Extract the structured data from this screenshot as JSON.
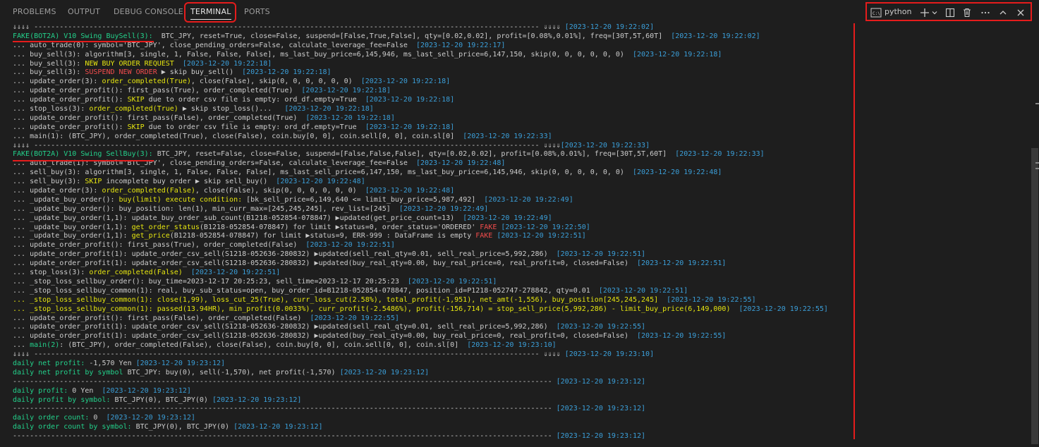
{
  "tabs": [
    {
      "label": "PROBLEMS"
    },
    {
      "label": "OUTPUT"
    },
    {
      "label": "DEBUG CONSOLE"
    },
    {
      "label": "TERMINAL"
    },
    {
      "label": "PORTS"
    }
  ],
  "toolbar": {
    "terminal_name": "python",
    "icons": [
      "terminal-icon",
      "plus-icon",
      "chevron-down-icon",
      "split-icon",
      "trash-icon",
      "more-icon",
      "chevron-up-icon",
      "close-icon"
    ]
  },
  "colors": {
    "timestamp": "#3b9fd9",
    "green": "#23d18b",
    "yellow": "#e5e510",
    "red": "#f14c4c",
    "highlight": "#e51c1c"
  },
  "lines": [
    [
      [
        "sep",
        "⇓⇓⇓⇓ ----------------------------------------------------------------------------------------------------------------------- ⇓⇓⇓⇓ "
      ],
      [
        "ts",
        "[2023-12-20 19:22:02]"
      ]
    ],
    [
      [
        "green",
        "FAKE(BOT2A) V10 Swing BuySell(3):"
      ],
      [
        "",
        "  BTC_JPY, reset=True, close=False, suspend=[False,True,False], qty=[0.02,0.02], profit=[0.08%,0.01%], freq=[30T,5T,60T]  "
      ],
      [
        "ts",
        "[2023-12-20 19:22:02]"
      ]
    ],
    [
      [
        "",
        "... auto_trade(0): symbol='BTC_JPY', close_pending_orders=False, calculate_leverage_fee=False  "
      ],
      [
        "ts",
        "[2023-12-20 19:22:17]"
      ]
    ],
    [
      [
        "",
        "... buy_sell(3): algorithm[3, single, 1, False, False, False], ms_last_buy_price=6,145,946, ms_last_sell_price=6,147,150, skip(0, 0, 0, 0, 0, 0)  "
      ],
      [
        "ts",
        "[2023-12-20 19:22:18]"
      ]
    ],
    [
      [
        "",
        "... buy_sell(3): "
      ],
      [
        "yellow",
        "NEW BUY ORDER REQUEST"
      ],
      [
        "",
        "  "
      ],
      [
        "ts",
        "[2023-12-20 19:22:18]"
      ]
    ],
    [
      [
        "",
        "... buy_sell(3): "
      ],
      [
        "red",
        "SUSPEND NEW ORDER"
      ],
      [
        "",
        " ▶ skip buy_sell()  "
      ],
      [
        "ts",
        "[2023-12-20 19:22:18]"
      ]
    ],
    [
      [
        "",
        "... update_order(3): "
      ],
      [
        "yellow",
        "order_completed(True)"
      ],
      [
        "",
        ", close(False), skip(0, 0, 0, 0, 0, 0)  "
      ],
      [
        "ts",
        "[2023-12-20 19:22:18]"
      ]
    ],
    [
      [
        "",
        "... update_order_profit(): first_pass(True), order_completed(True)  "
      ],
      [
        "ts",
        "[2023-12-20 19:22:18]"
      ]
    ],
    [
      [
        "",
        "... update_order_profit(): "
      ],
      [
        "yellow",
        "SKIP"
      ],
      [
        "",
        " due to order csv file is empty: ord_df.empty=True  "
      ],
      [
        "ts",
        "[2023-12-20 19:22:18]"
      ]
    ],
    [
      [
        "",
        "... stop_loss(3): "
      ],
      [
        "yellow",
        "order_completed(True)"
      ],
      [
        "",
        " ▶ skip stop_loss()...   "
      ],
      [
        "ts",
        "[2023-12-20 19:22:18]"
      ]
    ],
    [
      [
        "",
        "... update_order_profit(): first_pass(False), order_completed(True)  "
      ],
      [
        "ts",
        "[2023-12-20 19:22:18]"
      ]
    ],
    [
      [
        "",
        "... update_order_profit(): "
      ],
      [
        "yellow",
        "SKIP"
      ],
      [
        "",
        " due to order csv file is empty: ord_df.empty=True  "
      ],
      [
        "ts",
        "[2023-12-20 19:22:18]"
      ]
    ],
    [
      [
        "",
        "... main(1): (BTC_JPY), order_completed(True), close(False), coin.buy[0, 0], coin.sell[0, 0], coin.sl[0]  "
      ],
      [
        "ts",
        "[2023-12-20 19:22:33]"
      ]
    ],
    [
      [
        "sep",
        "⇓⇓⇓⇓ ----------------------------------------------------------------------------------------------------------------------- ⇓⇓⇓⇓"
      ],
      [
        "ts",
        "[2023-12-20 19:22:33]"
      ]
    ],
    [
      [
        "green",
        "FAKE(BOT2A) V10 Swing SellBuy(3):"
      ],
      [
        "",
        " BTC_JPY, reset=False, close=False, suspend=[False,False,False], qty=[0.02,0.02], profit=[0.08%,0.01%], freq=[30T,5T,60T]  "
      ],
      [
        "ts",
        "[2023-12-20 19:22:33]"
      ]
    ],
    [
      [
        "",
        "... auto_trade(1): symbol='BTC_JPY', close_pending_orders=False, calculate_leverage_fee=False  "
      ],
      [
        "ts",
        "[2023-12-20 19:22:48]"
      ]
    ],
    [
      [
        "",
        "... sell_buy(3): algorithm[3, single, 1, False, False, False], ms_last_sell_price=6,147,150, ms_last_buy_price=6,145,946, skip(0, 0, 0, 0, 0, 0)  "
      ],
      [
        "ts",
        "[2023-12-20 19:22:48]"
      ]
    ],
    [
      [
        "",
        "... sell_buy(3): "
      ],
      [
        "yellow",
        "SKIP"
      ],
      [
        "",
        " incomplete buy order ▶ skip sell_buy()  "
      ],
      [
        "ts",
        "[2023-12-20 19:22:48]"
      ]
    ],
    [
      [
        "",
        "... update_order(3): "
      ],
      [
        "yellow",
        "order_completed(False)"
      ],
      [
        "",
        ", close(False), skip(0, 0, 0, 0, 0, 0)  "
      ],
      [
        "ts",
        "[2023-12-20 19:22:48]"
      ]
    ],
    [
      [
        "",
        "... _update_buy_order(): "
      ],
      [
        "yellow",
        "buy(limit) execute condition:"
      ],
      [
        "",
        " [bk_sell_price=6,149,640 <= limit_buy_price=5,987,492]  "
      ],
      [
        "ts",
        "[2023-12-20 19:22:49]"
      ]
    ],
    [
      [
        "",
        "... _update_buy_order(): buy_position: len(1), min_curr_max=[245,245,245], rev_list=[245]  "
      ],
      [
        "ts",
        "[2023-12-20 19:22:49]"
      ]
    ],
    [
      [
        "",
        "... _update_buy_order(1,1): update_buy_order_sub_count(B1218-052854-078847) ▶updated(get_price_count=13)  "
      ],
      [
        "ts",
        "[2023-12-20 19:22:49]"
      ]
    ],
    [
      [
        "",
        "... _update_buy_order(1,1): "
      ],
      [
        "yellow",
        "get_order_status"
      ],
      [
        "",
        "(B1218-052854-078847) for limit ▶status=0, order_status='ORDERED' "
      ],
      [
        "red",
        "FAKE"
      ],
      [
        "",
        " "
      ],
      [
        "ts",
        "[2023-12-20 19:22:50]"
      ]
    ],
    [
      [
        "",
        "... _update_buy_order(1,1): "
      ],
      [
        "yellow",
        "get_price"
      ],
      [
        "",
        "(B1218-052854-078847) for limit ▶status=9, ERR-999 : DataFrame is empty "
      ],
      [
        "red",
        "FAKE"
      ],
      [
        "",
        " "
      ],
      [
        "ts",
        "[2023-12-20 19:22:51]"
      ]
    ],
    [
      [
        "",
        "... update_order_profit(): first_pass(True), order_completed(False)  "
      ],
      [
        "ts",
        "[2023-12-20 19:22:51]"
      ]
    ],
    [
      [
        "",
        "... update_order_profit(1): update_order_csv_sell(S1218-052636-280832) ▶updated(sell_real_qty=0.01, sell_real_price=5,992,286)  "
      ],
      [
        "ts",
        "[2023-12-20 19:22:51]"
      ]
    ],
    [
      [
        "",
        "... update_order_profit(1): update_order_csv_sell(S1218-052636-280832) ▶updated(buy_real_qty=0.00, buy_real_price=0, real_profit=0, closed=False)  "
      ],
      [
        "ts",
        "[2023-12-20 19:22:51]"
      ]
    ],
    [
      [
        "",
        "... stop_loss(3): "
      ],
      [
        "yellow",
        "order_completed(False)"
      ],
      [
        "",
        "  "
      ],
      [
        "ts",
        "[2023-12-20 19:22:51]"
      ]
    ],
    [
      [
        "",
        "... _stop_loss_sellbuy_order(): buy_time=2023-12-17 20:25:23, sell_time=2023-12-17 20:25:23  "
      ],
      [
        "ts",
        "[2023-12-20 19:22:51]"
      ]
    ],
    [
      [
        "",
        "... _stop_loss_sellbuy_common(1): real, buy_sub_status=open, buy_order_id=B1218-052854-078847, position_id=P1218-052747-278842, qty=0.01  "
      ],
      [
        "ts",
        "[2023-12-20 19:22:51]"
      ]
    ],
    [
      [
        "yellow",
        "... _stop_loss_sellbuy_common(1): close(1,99), loss_cut_25(True), curr_loss_cut(2.58%), total_profit(-1,951), net_amt(-1,556), buy_position[245,245,245]"
      ],
      [
        "",
        "  "
      ],
      [
        "ts",
        "[2023-12-20 19:22:55]"
      ]
    ],
    [
      [
        "yellow",
        "... _stop_loss_sellbuy_common(1): passed(13.94HR), min_profit(0.0033%), curr_profit(-2.5486%), profit(-156,714) = stop_sell_price(5,992,286) - limit_buy_price(6,149,000)"
      ],
      [
        "",
        "  "
      ],
      [
        "ts",
        "[2023-12-20 19:22:55]"
      ]
    ],
    [
      [
        "",
        "... update_order_profit(): first_pass(False), order_completed(False)  "
      ],
      [
        "ts",
        "[2023-12-20 19:22:55]"
      ]
    ],
    [
      [
        "",
        "... update_order_profit(1): update_order_csv_sell(S1218-052636-280832) ▶updated(sell_real_qty=0.01, sell_real_price=5,992,286)  "
      ],
      [
        "ts",
        "[2023-12-20 19:22:55]"
      ]
    ],
    [
      [
        "",
        "... update_order_profit(1): update_order_csv_sell(S1218-052636-280832) ▶updated(buy_real_qty=0.00, buy_real_price=0, real_profit=0, closed=False)  "
      ],
      [
        "ts",
        "[2023-12-20 19:22:55]"
      ]
    ],
    [
      [
        "",
        "... "
      ],
      [
        "green",
        "main(2)"
      ],
      [
        "",
        ": (BTC_JPY), order_completed(False), close(False), coin.buy[0, 0], coin.sell[0, 0], coin.sl[0]  "
      ],
      [
        "ts",
        "[2023-12-20 19:23:10]"
      ]
    ],
    [
      [
        "sep",
        "⇓⇓⇓⇓ ----------------------------------------------------------------------------------------------------------------------- ⇓⇓⇓⇓ "
      ],
      [
        "ts",
        "[2023-12-20 19:23:10]"
      ]
    ],
    [
      [
        "green",
        "daily net profit:"
      ],
      [
        "",
        " -1,570 Yen "
      ],
      [
        "ts",
        "[2023-12-20 19:23:12]"
      ]
    ],
    [
      [
        "green",
        "daily net profit by symbol"
      ],
      [
        "",
        " BTC_JPY: buy(0), sell(-1,570), net profit(-1,570) "
      ],
      [
        "ts",
        "[2023-12-20 19:23:12]"
      ]
    ],
    [
      [
        "sep",
        "------------------------------------------------------------------------------------------------------------------------------- "
      ],
      [
        "ts",
        "[2023-12-20 19:23:12]"
      ]
    ],
    [
      [
        "green",
        "daily profit:"
      ],
      [
        "",
        " 0 Yen  "
      ],
      [
        "ts",
        "[2023-12-20 19:23:12]"
      ]
    ],
    [
      [
        "green",
        "daily profit by symbol:"
      ],
      [
        "",
        " BTC_JPY(0), BTC_JPY(0) "
      ],
      [
        "ts",
        "[2023-12-20 19:23:12]"
      ]
    ],
    [
      [
        "sep",
        "------------------------------------------------------------------------------------------------------------------------------- "
      ],
      [
        "ts",
        "[2023-12-20 19:23:12]"
      ]
    ],
    [
      [
        "green",
        "daily order count:"
      ],
      [
        "",
        " 0  "
      ],
      [
        "ts",
        "[2023-12-20 19:23:12]"
      ]
    ],
    [
      [
        "green",
        "daily order count by symbol:"
      ],
      [
        "",
        " BTC_JPY(0), BTC_JPY(0) "
      ],
      [
        "ts",
        "[2023-12-20 19:23:12]"
      ]
    ],
    [
      [
        "sep",
        "------------------------------------------------------------------------------------------------------------------------------- "
      ],
      [
        "ts",
        "[2023-12-20 19:23:12]"
      ]
    ]
  ]
}
